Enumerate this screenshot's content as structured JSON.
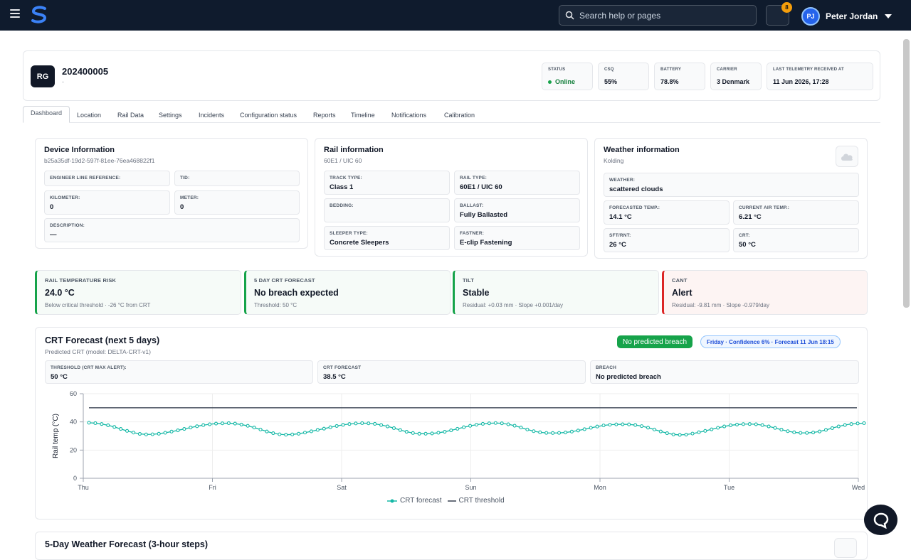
{
  "header": {
    "search_placeholder": "Search help or pages",
    "notifications_count": "8",
    "user_initials": "PJ",
    "user_name": "Peter Jordan"
  },
  "device": {
    "badge": "RG",
    "id": "202400005",
    "subtitle": "-",
    "stats": [
      {
        "label": "STATUS",
        "value": "Online"
      },
      {
        "label": "CSQ",
        "value": "55%"
      },
      {
        "label": "BATTERY",
        "value": "78.8%"
      },
      {
        "label": "CARRIER",
        "value": "3 Denmark"
      },
      {
        "label": "LAST TELEMETRY RECEIVED AT",
        "value": "11 Jun 2026, 17:28"
      }
    ]
  },
  "tabs": [
    "Dashboard",
    "Location",
    "Rail Data",
    "Settings",
    "Incidents",
    "Configuration status",
    "Reports",
    "Timeline",
    "Notifications",
    "Calibration"
  ],
  "device_info": {
    "title": "Device Information",
    "subtitle": "b25a35df-19d2-597f-81ee-76ea468822f1",
    "fields": [
      {
        "label": "ENGINEER LINE REFERENCE:",
        "value": ""
      },
      {
        "label": "TID:",
        "value": ""
      },
      {
        "label": "KILOMETER:",
        "value": "0"
      },
      {
        "label": "METER:",
        "value": "0"
      },
      {
        "label": "DESCRIPTION:",
        "value": "—"
      }
    ]
  },
  "rail_info": {
    "title": "Rail information",
    "subtitle": "60E1 / UIC 60",
    "fields": [
      {
        "label": "TRACK TYPE:",
        "value": "Class 1"
      },
      {
        "label": "RAIL TYPE:",
        "value": "60E1 / UIC 60"
      },
      {
        "label": "BEDDING:",
        "value": ""
      },
      {
        "label": "BALLAST:",
        "value": "Fully Ballasted"
      },
      {
        "label": "SLEEPER TYPE:",
        "value": "Concrete Sleepers"
      },
      {
        "label": "FASTNER:",
        "value": "E-clip Fastening"
      }
    ]
  },
  "weather_info": {
    "title": "Weather information",
    "subtitle": "Kolding",
    "icon": "cloud-icon",
    "fields": [
      {
        "label": "WEATHER:",
        "value": "scattered clouds"
      },
      {
        "label": "FORECASTED TEMP.:",
        "value": "14.1 °C"
      },
      {
        "label": "CURRENT AIR TEMP.:",
        "value": "6.21 °C"
      },
      {
        "label": "SFT/RNT:",
        "value": "26 °C"
      },
      {
        "label": "CRT:",
        "value": "50 °C"
      }
    ]
  },
  "kpis": [
    {
      "label": "RAIL TEMPERATURE RISK",
      "value": "24.0 °C",
      "note": "Below critical threshold · -26 °C from CRT"
    },
    {
      "label": "5 DAY CRT FORECAST",
      "value": "No breach expected",
      "note": "Threshold: 50 °C"
    },
    {
      "label": "TILT",
      "value": "Stable",
      "note": "Residual: +0.03 mm · Slope +0.001/day"
    },
    {
      "label": "CANT",
      "value": "Alert",
      "note": "Residual: -9.81 mm · Slope -0.979/day"
    }
  ],
  "colors": {
    "ok": "#16a34a",
    "alert": "#dc2626",
    "forecast_line": "#14b8a6",
    "threshold_line": "#374151",
    "brand": "#2563eb"
  },
  "forecast": {
    "title": "CRT Forecast (next 5 days)",
    "subtitle": "Predicted CRT (model: DELTA-CRT-v1)",
    "status_pill": "No predicted breach",
    "info_pill": "Friday · Confidence 6% · Forecast 11 Jun 18:15",
    "fields": [
      {
        "label": "THRESHOLD (CRT MAX ALERT):",
        "value": "50 °C"
      },
      {
        "label": "CRT FORECAST",
        "value": "38.5 °C"
      },
      {
        "label": "BREACH",
        "value": "No predicted breach"
      }
    ]
  },
  "chart_data": {
    "type": "line",
    "ylabel": "Rail temp (°C)",
    "xlabel": "",
    "ylim": [
      0,
      60
    ],
    "yticks": [
      0,
      20,
      40,
      60
    ],
    "x_ticks": [
      "Thu",
      "Fri",
      "Sat",
      "Sun",
      "Mon",
      "Tue",
      "Wed"
    ],
    "grid": true,
    "legend_position": "bottom",
    "series": [
      {
        "name": "CRT forecast",
        "values": [
          39.4,
          39.1,
          38.5,
          37.6,
          36.4,
          35.0,
          33.6,
          32.4,
          31.5,
          31.1,
          31.2,
          31.6,
          32.3,
          33.1,
          34.0,
          35.0,
          36.0,
          36.9,
          37.7,
          38.3,
          38.8,
          39.0,
          39.1,
          38.8,
          38.1,
          37.2,
          36.0,
          34.6,
          33.2,
          32.0,
          31.2,
          30.9,
          31.1,
          31.6,
          32.4,
          33.3,
          34.3,
          35.2,
          36.2,
          37.1,
          37.9,
          38.5,
          38.9,
          39.1,
          39.0,
          38.6,
          37.8,
          36.8,
          35.6,
          34.2,
          33.0,
          32.1,
          31.6,
          31.6,
          31.8,
          32.3,
          33.0,
          34.0,
          35.1,
          36.2,
          37.2,
          38.0,
          38.6,
          39.0,
          39.2,
          39.0,
          38.3,
          37.3,
          36.0,
          34.6,
          33.4,
          32.6,
          32.2,
          32.1,
          32.2,
          32.5,
          33.1,
          33.9,
          34.8,
          35.8,
          36.7,
          37.5,
          38.0,
          38.2,
          38.3,
          38.2,
          37.8,
          37.0,
          35.9,
          34.6,
          33.2,
          32.0,
          31.1,
          30.8,
          31.0,
          31.7,
          32.6,
          33.6,
          34.7,
          35.8,
          36.8,
          37.6,
          38.1,
          38.4,
          38.5,
          38.3,
          37.7,
          36.8,
          35.7,
          34.5,
          33.4,
          32.6,
          32.2,
          32.2,
          32.5,
          33.2,
          34.3,
          35.6,
          36.8,
          37.8,
          38.5,
          38.9,
          39.1
        ]
      },
      {
        "name": "CRT threshold",
        "values": [
          50,
          50
        ]
      }
    ]
  },
  "weather_forecast": {
    "title": "5-Day Weather Forecast (3-hour steps)"
  }
}
